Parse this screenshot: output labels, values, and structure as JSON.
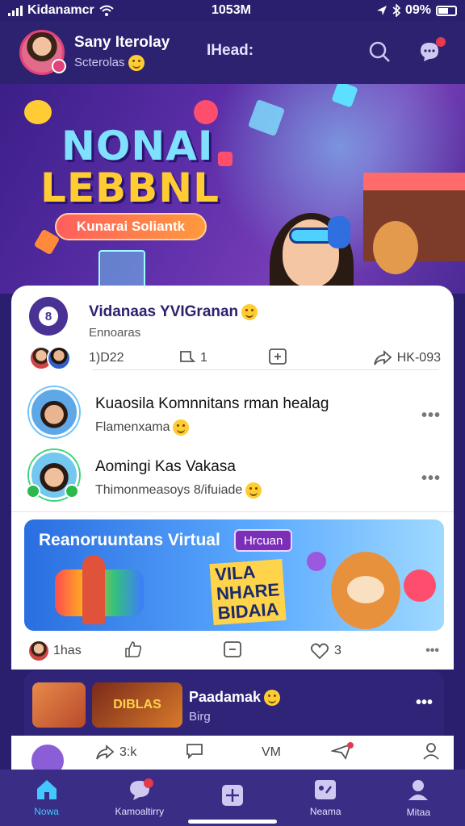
{
  "status_bar": {
    "carrier": "Kidanamcr",
    "time": "1053M",
    "battery": "09%"
  },
  "header": {
    "user_name": "Sany Iterolay",
    "user_sub": "Scterolas",
    "title": "IHead:"
  },
  "hero": {
    "title_line1": "NONAI",
    "title_line2": "LEBBNL",
    "pill_label": "Kunarai Soliantk"
  },
  "feed": {
    "post": {
      "title": "Vidanaas YVIGranan",
      "sub": "Ennoaras",
      "stat": "1)D22",
      "comments": "1",
      "share_count": "HK-093"
    },
    "items": [
      {
        "title": "Kuaosila Komnnitans rman healag",
        "sub": "Flamenxama"
      },
      {
        "title": "Aomingi Kas Vakasa",
        "sub": "Thimonmeasoys  8/ifuiade"
      }
    ]
  },
  "promo": {
    "title": "Reanoruuntans Virtual",
    "tag": "Hrcuan",
    "big_line1": "VILA",
    "big_line2": "NHARE",
    "big_line3": "BIDAIA",
    "likes_label": "1has",
    "reactions": "3"
  },
  "sheet": {
    "thumb_text": "DIBLAS",
    "title": "Paadamak",
    "sub": "Birg"
  },
  "action_bar": {
    "share": "3:k",
    "center": "VM"
  },
  "bottom_nav": [
    {
      "label": "Nowa"
    },
    {
      "label": "Kamoaltirry"
    },
    {
      "label": ""
    },
    {
      "label": "Neama"
    },
    {
      "label": "Mitaa"
    }
  ]
}
